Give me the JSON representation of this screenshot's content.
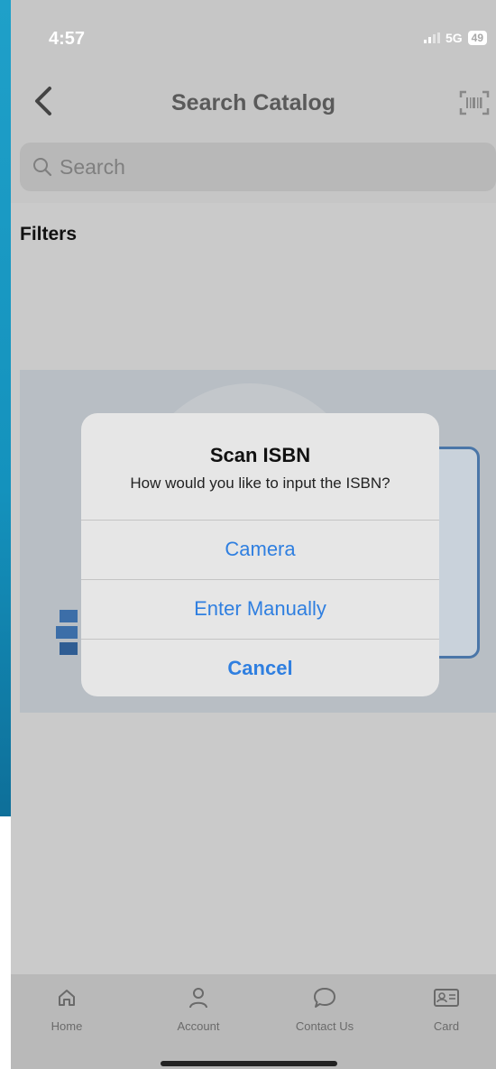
{
  "status_bar": {
    "time": "4:57",
    "network": "5G",
    "battery": "49"
  },
  "nav": {
    "title": "Search Catalog",
    "back_icon": "chevron-left-icon",
    "scan_icon": "barcode-scan-icon"
  },
  "search": {
    "placeholder": "Search"
  },
  "filters": {
    "label": "Filters"
  },
  "dialog": {
    "title": "Scan ISBN",
    "message": "How would you like to input the ISBN?",
    "buttons": {
      "camera": "Camera",
      "manual": "Enter Manually",
      "cancel": "Cancel"
    }
  },
  "tab_bar": {
    "items": [
      {
        "label": "Home",
        "icon": "home-icon"
      },
      {
        "label": "Account",
        "icon": "user-icon"
      },
      {
        "label": "Contact Us",
        "icon": "chat-bubble-icon"
      },
      {
        "label": "Card",
        "icon": "library-card-icon"
      }
    ]
  },
  "colors": {
    "accent": "#2f7fe0",
    "strip": "#1492bd"
  }
}
